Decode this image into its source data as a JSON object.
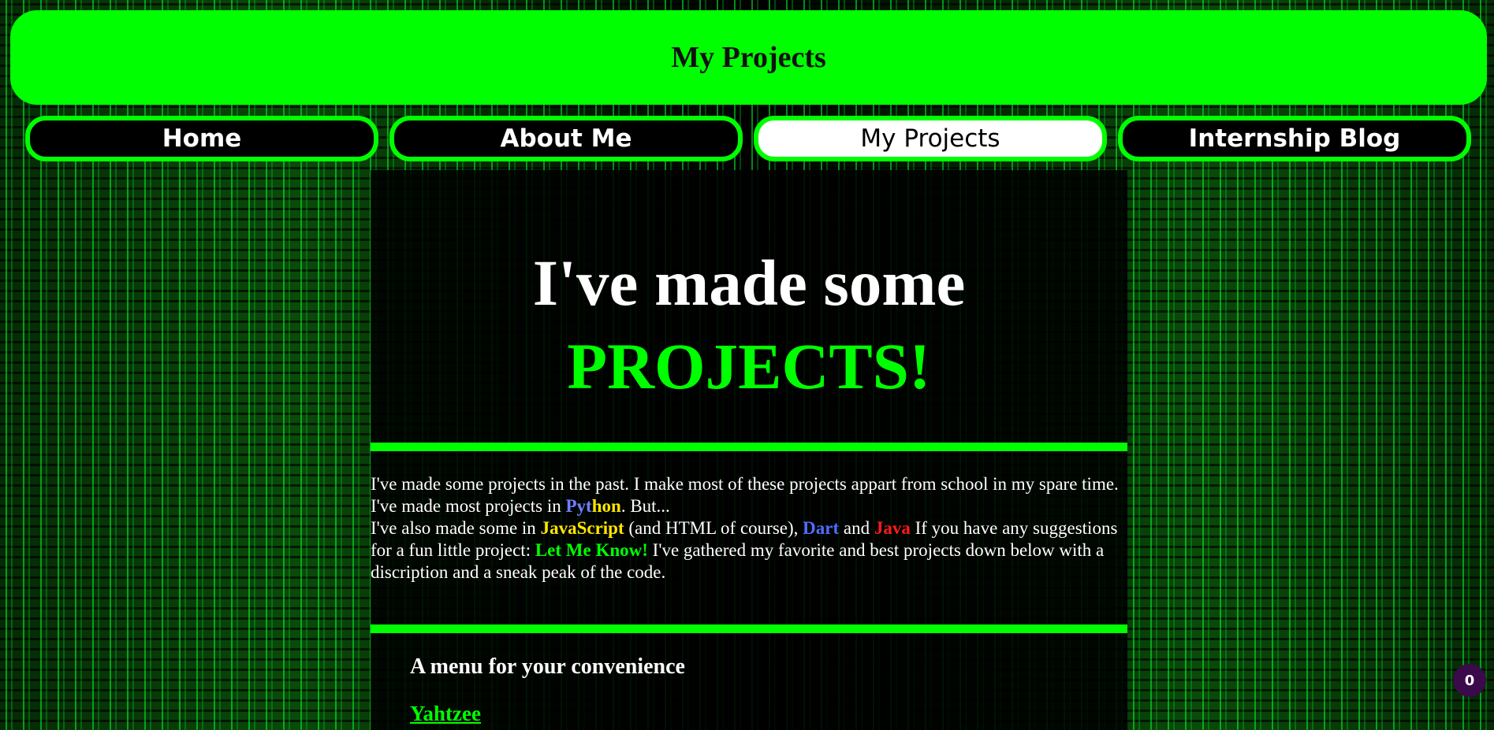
{
  "header": {
    "title": "My Projects"
  },
  "nav": {
    "items": [
      {
        "label": "Home"
      },
      {
        "label": "About Me"
      },
      {
        "label": "My Projects"
      },
      {
        "label": "Internship Blog"
      }
    ],
    "active_index": 2
  },
  "hero": {
    "line1": "I've made some",
    "line2": "PROJECTS!"
  },
  "intro": {
    "line1": "I've made some projects in the past. I make most of these projects appart from school in my spare time.",
    "line2_before": "I've made most projects in ",
    "python_part1": "Pyt",
    "python_part2": "hon",
    "line2_after": ". But...",
    "line3_before": "I've also made some in ",
    "javascript": "JavaScript",
    "line3_mid1": " (and HTML of course), ",
    "dart": "Dart",
    "line3_mid2": " and ",
    "java": "Java",
    "line3_mid3": " If you have any suggestions for a fun little project: ",
    "let_me_know": "Let Me Know!",
    "line3_after": " I've gathered my favorite and best projects down below with a discription and a sneak peak of the code."
  },
  "menu": {
    "title": "A menu for your convenience",
    "items": [
      {
        "label": "Yahtzee"
      }
    ]
  },
  "badge": {
    "count": "0"
  },
  "colors": {
    "accent": "#00ff00",
    "python_a": "#6f7fff",
    "python_b": "#ffe600",
    "javascript": "#ffe600",
    "dart": "#4f6dff",
    "java": "#ff1a1a"
  }
}
